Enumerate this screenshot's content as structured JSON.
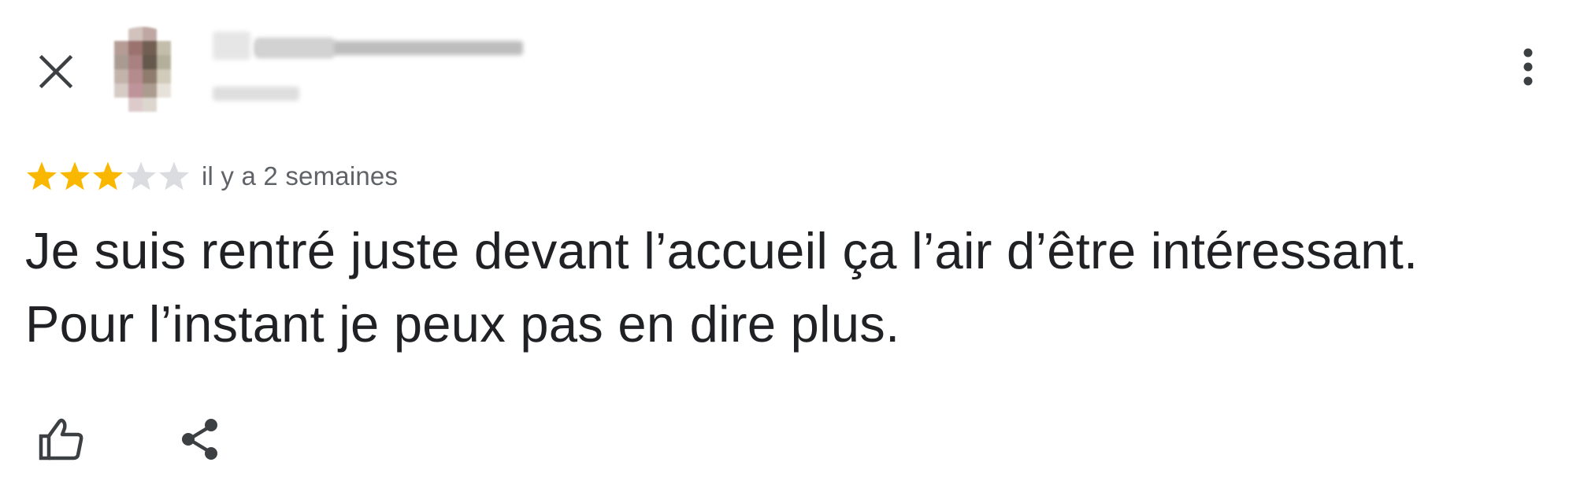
{
  "header": {
    "close_icon": "close-icon",
    "more_icon": "more-vert-icon"
  },
  "review": {
    "rating": 3,
    "max_rating": 5,
    "date": "il y a 2 semaines",
    "text": "Je suis rentré juste devant l’accueil ça l’air d’être intéressant.\nPour l’instant je peux pas en dire plus."
  },
  "actions": {
    "like_icon": "thumb-up-icon",
    "share_icon": "share-icon"
  },
  "colors": {
    "star_filled": "#F9B700",
    "star_empty": "#DADCE0",
    "text": "#202124",
    "secondary_text": "#5F6368",
    "icon": "#3C4043"
  }
}
